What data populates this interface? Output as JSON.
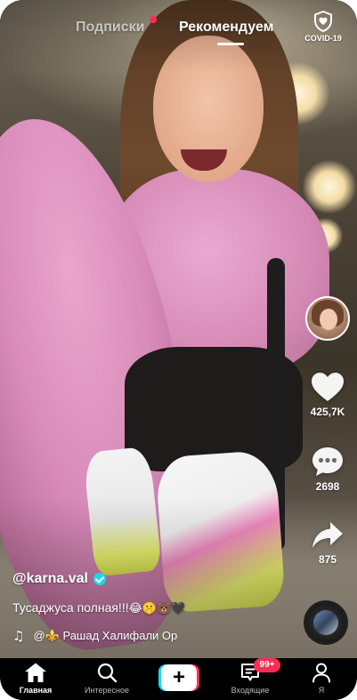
{
  "top_tabs": {
    "following": "Подписки",
    "for_you": "Рекомендуем",
    "active": "for_you",
    "following_has_new": true
  },
  "covid_button": {
    "label": "COVID-19",
    "icon": "shield-heart-icon"
  },
  "actions": {
    "like": {
      "count": "425,7K",
      "icon": "heart-icon"
    },
    "comment": {
      "count": "2698",
      "icon": "comment-bubble-icon"
    },
    "share": {
      "count": "875",
      "icon": "share-arrow-icon"
    }
  },
  "creator": {
    "username": "@karna.val",
    "verified": true
  },
  "caption": {
    "text": "Тусаджуса полная!!!",
    "emojis": "😂🤫🐻🖤"
  },
  "sound": {
    "text": "@⚜️ Рашад Халифали Ор"
  },
  "bottom_nav": {
    "items": [
      {
        "label": "Главная",
        "icon": "home-icon",
        "active": true
      },
      {
        "label": "Интересное",
        "icon": "search-icon",
        "active": false
      },
      {
        "label": "",
        "icon": "plus-icon",
        "active": false
      },
      {
        "label": "Входящие",
        "icon": "inbox-icon",
        "active": false,
        "badge": "99+"
      },
      {
        "label": "Я",
        "icon": "profile-icon",
        "active": false
      }
    ]
  },
  "colors": {
    "accent_red": "#fe2c55",
    "accent_cyan": "#20d5ec",
    "nav_background": "#000000",
    "text": "#ffffff"
  }
}
